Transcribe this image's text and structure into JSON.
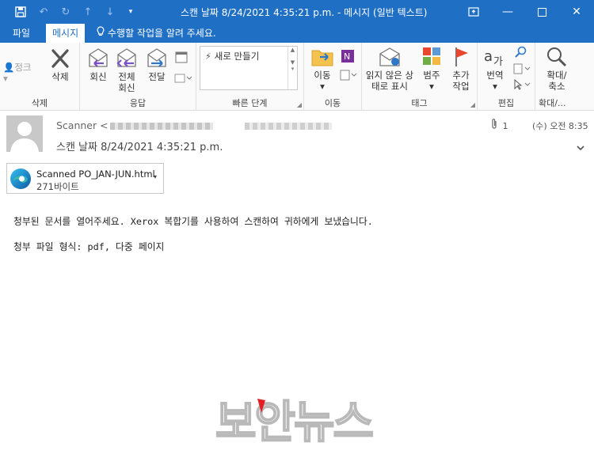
{
  "window": {
    "title": "스캔 날짜 8/24/2021 4:35:21 p.m. - 메시지 (일반 텍스트)"
  },
  "tabs": [
    {
      "label": "파일",
      "active": false
    },
    {
      "label": "메시지",
      "active": true
    }
  ],
  "tell_me": "수행할 작업을 알려 주세요.",
  "ribbon": {
    "delete_group": {
      "label": "삭제",
      "junk": "정크",
      "delete": "삭제"
    },
    "respond_group": {
      "label": "응답",
      "reply": "회신",
      "reply_all": "전체 회신",
      "forward": "전달"
    },
    "quick_steps_group": {
      "label": "빠른 단계",
      "create_new": "새로 만들기"
    },
    "move_group": {
      "label": "이동",
      "move": "이동"
    },
    "tags_group": {
      "label": "태그",
      "mark_unread": "읽지 않은 상태로 표시",
      "categorize": "범주",
      "follow_up": "추가 작업"
    },
    "editing_group": {
      "label": "편집",
      "translate": "번역"
    },
    "zoom_group": {
      "label": "확대/...",
      "zoom": "확대/축소"
    }
  },
  "message": {
    "sender_name": "Scanner <",
    "subject": "스캔 날짜 8/24/2021 4:35:21 p.m.",
    "attachment_count": "1",
    "received": "(수) 오전 8:35",
    "attachment": {
      "name": "Scanned PO_JAN-JUN.html",
      "size": "271바이트"
    },
    "body": [
      "청부된 문서를 열어주세요. Xerox 복합기를 사용하여 스캔하여 귀하에게 보냈습니다.",
      "청부 파일 형식: pdf, 다중 페이지"
    ]
  },
  "watermark": "보안뉴스",
  "colors": {
    "accent": "#1f6fc5",
    "reply_arrow": "#7b4fc6",
    "forward_arrow": "#2f77c8",
    "flag": "#e8472f"
  }
}
